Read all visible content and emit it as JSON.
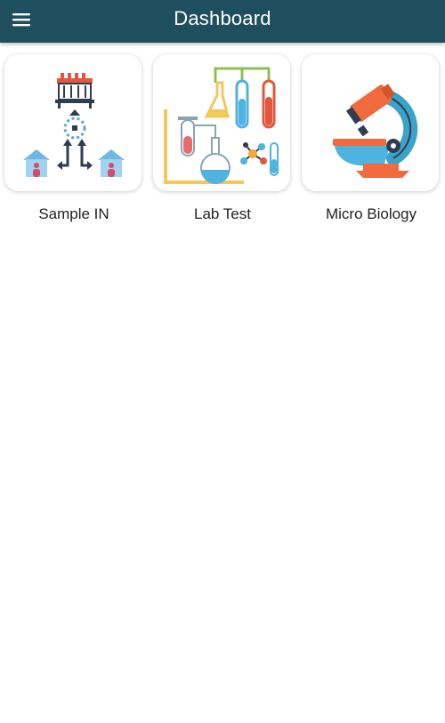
{
  "app_bar": {
    "title": "Dashboard",
    "menu_icon": "menu-icon",
    "background": "#1f4e5f"
  },
  "tiles": [
    {
      "label": "Sample IN",
      "icon": "sample-in-icon"
    },
    {
      "label": "Lab Test",
      "icon": "lab-test-icon"
    },
    {
      "label": "Micro Biology",
      "icon": "microscope-icon"
    }
  ]
}
